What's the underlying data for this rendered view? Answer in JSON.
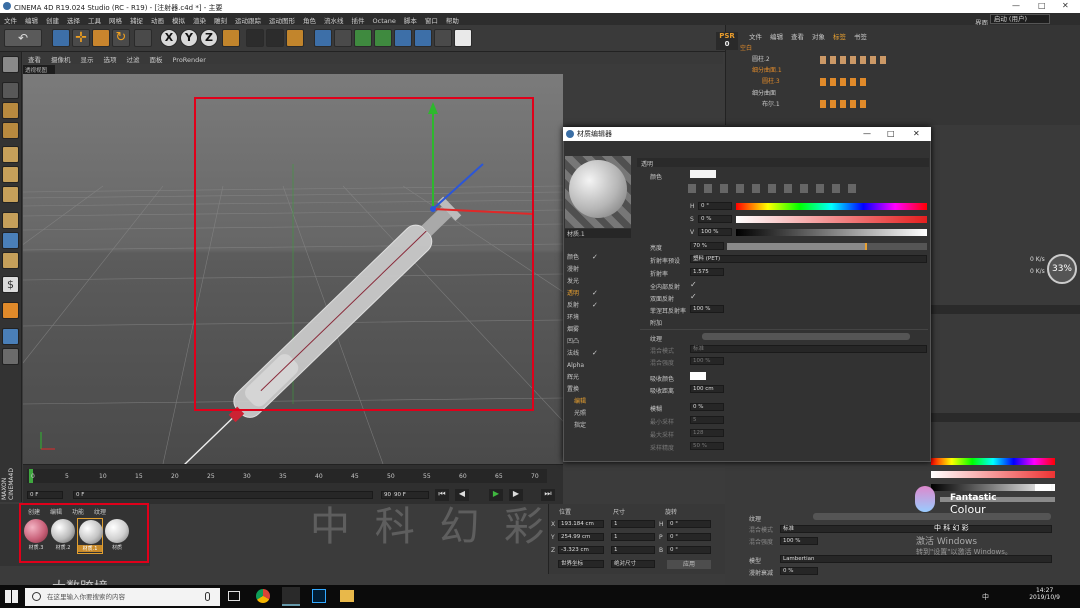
{
  "window": {
    "title": "CINEMA 4D R19.024 Studio (RC - R19) - [注射器.c4d *] - 主要"
  },
  "menu": [
    "文件",
    "编辑",
    "创建",
    "选择",
    "工具",
    "网格",
    "捕捉",
    "动画",
    "模拟",
    "渲染",
    "雕刻",
    "运动跟踪",
    "运动图形",
    "角色",
    "流水线",
    "插件",
    "Octane",
    "脚本",
    "窗口",
    "帮助"
  ],
  "layout": {
    "label": "界面",
    "value": "启动 (用户)"
  },
  "viewport": {
    "menu": [
      "查看",
      "摄像机",
      "显示",
      "选项",
      "过滤",
      "面板",
      "ProRender"
    ],
    "tab": "透视视图"
  },
  "timeline": {
    "ticks": [
      "0",
      "5",
      "10",
      "15",
      "20",
      "25",
      "30",
      "35",
      "40",
      "45",
      "50",
      "55",
      "60",
      "65",
      "70"
    ],
    "frame_start": "0 F",
    "frame_current": "0 F",
    "frame_end": "90 F",
    "frame_max": "90 F"
  },
  "material_manager": {
    "menu": [
      "创建",
      "编辑",
      "功能",
      "纹理"
    ],
    "materials": [
      {
        "name": "材质.3",
        "color": "#c9627a"
      },
      {
        "name": "材质.2",
        "color": "#d6d6d6"
      },
      {
        "name": "材质.1",
        "color": "#e0e0e0"
      },
      {
        "name": "材质",
        "color": "#e7e7e7"
      }
    ]
  },
  "coordinates": {
    "headers": [
      "位置",
      "尺寸",
      "旋转"
    ],
    "rows": [
      {
        "axis": "X",
        "pos": "193.184 cm",
        "size": "1",
        "rlabel": "H",
        "rot": "0 °"
      },
      {
        "axis": "Y",
        "pos": "254.99 cm",
        "size": "1",
        "rlabel": "P",
        "rot": "0 °"
      },
      {
        "axis": "Z",
        "pos": "-3.323 cm",
        "size": "1",
        "rlabel": "B",
        "rot": "0 °"
      }
    ],
    "mode1": "世界坐标",
    "mode2": "绝对尺寸",
    "apply": "应用"
  },
  "object_manager": {
    "menu": [
      "文件",
      "编辑",
      "查看",
      "对象",
      "标签",
      "书签"
    ],
    "psr": "PSR",
    "psr_value": "0",
    "objects": [
      {
        "name": "空白",
        "highlight": true
      },
      {
        "name": "圆柱.2",
        "highlight": false
      },
      {
        "name": "细分曲面.1",
        "highlight": true
      },
      {
        "name": "圆柱.3",
        "highlight": true
      },
      {
        "name": "细分曲面",
        "highlight": false
      },
      {
        "name": "布尔.1",
        "highlight": false
      }
    ]
  },
  "material_editor": {
    "title": "材质编辑器",
    "material_name": "材质.1",
    "section": "透明",
    "channels": [
      {
        "label": "颜色",
        "checked": true,
        "active": false
      },
      {
        "label": "漫射",
        "checked": false,
        "active": false
      },
      {
        "label": "发光",
        "checked": false,
        "active": false
      },
      {
        "label": "透明",
        "checked": true,
        "active": true
      },
      {
        "label": "反射",
        "checked": true,
        "active": false
      },
      {
        "label": "环境",
        "checked": false,
        "active": false
      },
      {
        "label": "烟雾",
        "checked": false,
        "active": false
      },
      {
        "label": "凹凸",
        "checked": false,
        "active": false
      },
      {
        "label": "法线",
        "checked": true,
        "active": false
      },
      {
        "label": "Alpha",
        "checked": false,
        "active": false
      },
      {
        "label": "辉光",
        "checked": false,
        "active": false
      },
      {
        "label": "置换",
        "checked": false,
        "active": false
      }
    ],
    "extra": [
      "编辑",
      "光照",
      "指定"
    ],
    "color_label": "颜色",
    "h_label": "H",
    "h_value": "0 °",
    "s_label": "S",
    "s_value": "0 %",
    "v_label": "V",
    "v_value": "100 %",
    "brightness_label": "亮度",
    "brightness_value": "70 %",
    "brightness_fraction": 0.7,
    "ior_preset_label": "折射率预设",
    "ior_preset_value": "塑料 (PET)",
    "ior_label": "折射率",
    "ior_value": "1.575",
    "total_internal": "全内部反射",
    "double_reflect": "双面反射",
    "fresnel_label": "菲涅耳反射率",
    "fresnel_value": "100 %",
    "additive": "附加",
    "texture_label": "纹理",
    "mix_mode_label": "混合模式",
    "mix_mode_value": "标准",
    "mix_strength_label": "混合强度",
    "mix_strength_value": "100 %",
    "absorb_color_label": "吸收颜色",
    "absorb_dist_label": "吸收距离",
    "absorb_dist_value": "100 cm",
    "blur_label": "模糊",
    "blur_value": "0 %",
    "min_samples_label": "最小采样",
    "min_samples_value": "5",
    "max_samples_label": "最大采样",
    "max_samples_value": "128",
    "accuracy_label": "采样精度",
    "accuracy_value": "50 %"
  },
  "attribute_panel": {
    "texture_label": "纹理",
    "mix_mode_label": "混合模式",
    "mix_mode_value": "标准",
    "mix_strength_label": "混合强度",
    "mix_strength_value": "100 %",
    "model_label": "模型",
    "model_value": "Lambertian",
    "rough_label": "漫射衰减",
    "rough_value": "0 %"
  },
  "perf": {
    "net_up": "0 K/s",
    "net_down": "0 K/s",
    "gauge": "33%"
  },
  "watermarks": {
    "brand": "Fantastic",
    "brand2": "Colour",
    "brand_cn": "中 科 幻 彩",
    "activate1": "激活 Windows",
    "activate2": "转到\"设置\"以激活 Windows。",
    "big_cn": "中 科 幻 彩",
    "bottom_left": "大数跨境"
  },
  "taskbar": {
    "search_placeholder": "在这里输入你要搜索的内容",
    "time": "14:27",
    "date": "2019/10/9",
    "lang": "中"
  }
}
